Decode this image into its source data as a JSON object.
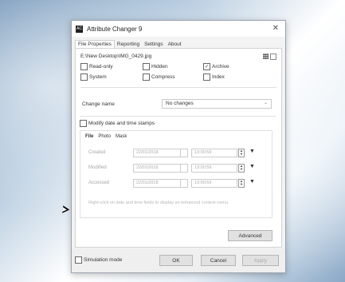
{
  "window": {
    "title": "Attribute Changer 9"
  },
  "tabs": [
    {
      "label": "File Properties",
      "active": true
    },
    {
      "label": "Reporting"
    },
    {
      "label": "Settings"
    },
    {
      "label": "About"
    }
  ],
  "file": {
    "path": "E:\\New Desktop\\IMG_0429.jpg"
  },
  "attributes": [
    {
      "label": "Read-only",
      "checked": false
    },
    {
      "label": "Hidden",
      "checked": false
    },
    {
      "label": "Archive",
      "checked": true
    },
    {
      "label": "System",
      "checked": false
    },
    {
      "label": "Compress",
      "checked": false
    },
    {
      "label": "Index",
      "checked": false
    }
  ],
  "change_names": {
    "label": "Change name",
    "value": "No changes"
  },
  "modify_dates": {
    "label": "Modify date and time stamps",
    "checked": false
  },
  "subtabs": [
    {
      "label": "File",
      "active": true
    },
    {
      "label": "Photo"
    },
    {
      "label": "Mask"
    }
  ],
  "date_rows": [
    {
      "label": "Created",
      "date": "22/01/2018",
      "time": "13:00:59"
    },
    {
      "label": "Modified",
      "date": "22/01/2018",
      "time": "13:00:59"
    },
    {
      "label": "Accessed",
      "date": "22/01/2018",
      "time": "13:00:59"
    }
  ],
  "hint": "Right-click on date and time fields to display an enhanced context menu.",
  "buttons": {
    "advanced": "Advanced",
    "ok": "OK",
    "cancel": "Cancel",
    "apply": "Apply"
  },
  "simulation_mode": {
    "label": "Simulation mode",
    "checked": false
  }
}
